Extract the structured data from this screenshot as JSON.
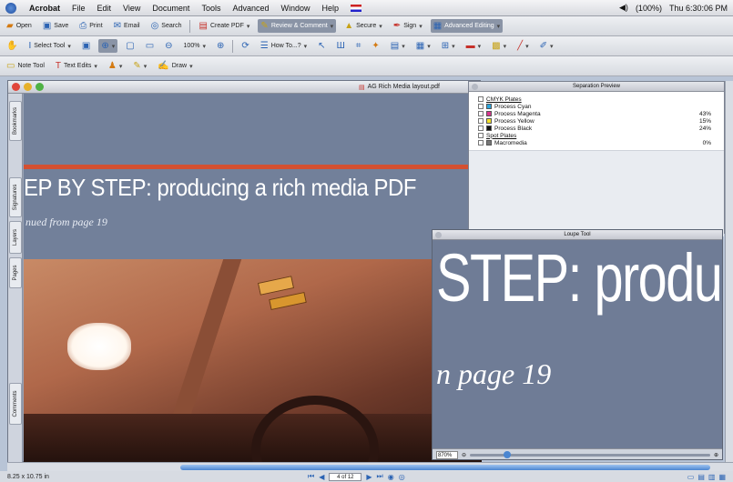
{
  "menubar": {
    "app": "Acrobat",
    "items": [
      "File",
      "Edit",
      "View",
      "Document",
      "Tools",
      "Advanced",
      "Window",
      "Help"
    ],
    "battery": "(100%)",
    "clock": "Thu 6:30:06 PM"
  },
  "toolbar1": {
    "open": "Open",
    "save": "Save",
    "print": "Print",
    "email": "Email",
    "search": "Search",
    "create_pdf": "Create PDF",
    "review": "Review & Comment",
    "secure": "Secure",
    "sign": "Sign",
    "advanced_editing": "Advanced Editing"
  },
  "toolbar2": {
    "select_tool": "Select Tool",
    "zoom": "100%",
    "how_to": "How To...?"
  },
  "toolbar3": {
    "note_tool": "Note Tool",
    "text_edits": "Text Edits",
    "draw": "Draw"
  },
  "document": {
    "title": "AG Rich Media layout.pdf",
    "headline": "EP BY STEP: producing a rich media PDF",
    "subhead": "nued from page 19"
  },
  "sidetabs": [
    "Bookmarks",
    "Signatures",
    "Layers",
    "Pages",
    "Comments"
  ],
  "separation_preview": {
    "title": "Separation Preview",
    "plates": [
      {
        "name": "CMYK Plates",
        "pct": "",
        "color": "",
        "head": true
      },
      {
        "name": "Process Cyan",
        "pct": "",
        "color": "#2ba6de"
      },
      {
        "name": "Process Magenta",
        "pct": "43%",
        "color": "#d8368f"
      },
      {
        "name": "Process Yellow",
        "pct": "15%",
        "color": "#f2e02a"
      },
      {
        "name": "Process Black",
        "pct": "24%",
        "color": "#111111"
      },
      {
        "name": "Spot Plates",
        "pct": "",
        "color": "",
        "head": true
      },
      {
        "name": "Macromedia",
        "pct": "0%",
        "color": "#777777"
      }
    ]
  },
  "loupe": {
    "title": "Loupe Tool",
    "big_text": "STEP: produ",
    "big_sub": "n page 19",
    "zoom": "870%"
  },
  "status": {
    "dimensions": "8.25 x 10.75 in",
    "page": "4 of 12"
  }
}
